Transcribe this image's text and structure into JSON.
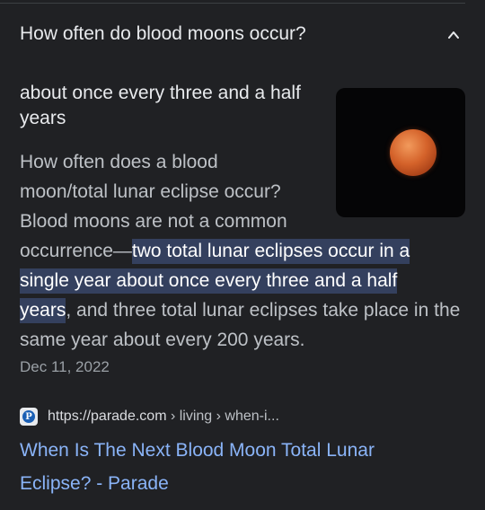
{
  "question": {
    "text": "How often do blood moons occur?",
    "toggle_icon": "chevron-up-icon"
  },
  "answer": {
    "text": "about once every three and a half years"
  },
  "image": {
    "icon": "blood-moon-image",
    "moon_color": "#d4622a",
    "background": "#050506"
  },
  "snippet": {
    "line1": "How often does a blood",
    "line2": "moon/total lunar eclipse occur?",
    "line3": "Blood moons are not a common",
    "pre_highlight": "occurrence—",
    "highlight_part1": "two total lunar eclipses occur in a",
    "highlight_part2": "single year about once every three and a half",
    "highlight_part3": "years",
    "post_highlight": ", and three total lunar eclipses take place in the same year about every 200 years."
  },
  "date": "Dec 11, 2022",
  "source": {
    "url_base": "https://parade.com",
    "url_path": " › living › when-i...",
    "favicon": "parade-favicon-icon"
  },
  "result": {
    "title": "When Is The Next Blood Moon Total Lunar Eclipse? - Parade"
  },
  "colors": {
    "background": "#202124",
    "highlight": "#34405e",
    "link": "#8ab4f8"
  }
}
